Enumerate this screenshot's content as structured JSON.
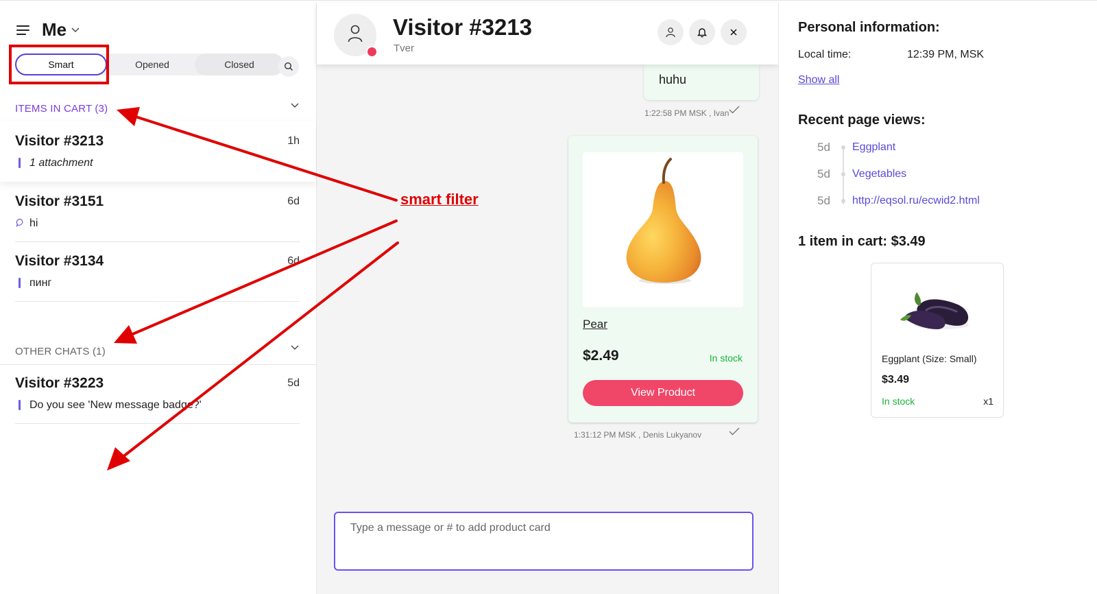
{
  "sidebar": {
    "user": "Me",
    "tabs": [
      "Smart",
      "Opened",
      "Closed"
    ],
    "sections": {
      "cart": "ITEMS IN CART (3)",
      "other": "OTHER CHATS (1)"
    },
    "chats": [
      {
        "name": "Visitor #3213",
        "time": "1h",
        "preview": "1 attachment"
      },
      {
        "name": "Visitor #3151",
        "time": "6d",
        "preview": "hi"
      },
      {
        "name": "Visitor #3134",
        "time": "6d",
        "preview": "пинг"
      },
      {
        "name": "Visitor #3223",
        "time": "5d",
        "preview": "Do you see 'New message badge?'"
      }
    ]
  },
  "chat": {
    "title": "Visitor #3213",
    "location": "Tver",
    "messages": [
      {
        "text": "huhu",
        "meta": "1:22:58 PM MSK , Ivan"
      }
    ],
    "product": {
      "name": "Pear",
      "price": "$2.49",
      "stock": "In stock",
      "button": "View Product",
      "meta": "1:31:12 PM MSK , Denis Lukyanov"
    },
    "composer_placeholder": "Type a message or # to add product card"
  },
  "info": {
    "personal_title": "Personal information:",
    "local_time_label": "Local time:",
    "local_time_value": "12:39 PM, MSK",
    "show_all": "Show all",
    "page_views_title": "Recent page views:",
    "page_views": [
      {
        "age": "5d",
        "link": "Eggplant"
      },
      {
        "age": "5d",
        "link": "Vegetables"
      },
      {
        "age": "5d",
        "link": "http://eqsol.ru/ecwid2.html"
      }
    ],
    "cart_title": "1 item in cart: $3.49",
    "cart_item": {
      "name": "Eggplant (Size: Small)",
      "price": "$3.49",
      "stock": "In stock",
      "qty": "x1"
    }
  },
  "annotation": {
    "label": "smart filter"
  },
  "colors": {
    "accent": "#5a3fd6",
    "link": "#5a49d8",
    "button": "#f04668",
    "stock": "#1bb33a",
    "annotation": "#e00000"
  }
}
